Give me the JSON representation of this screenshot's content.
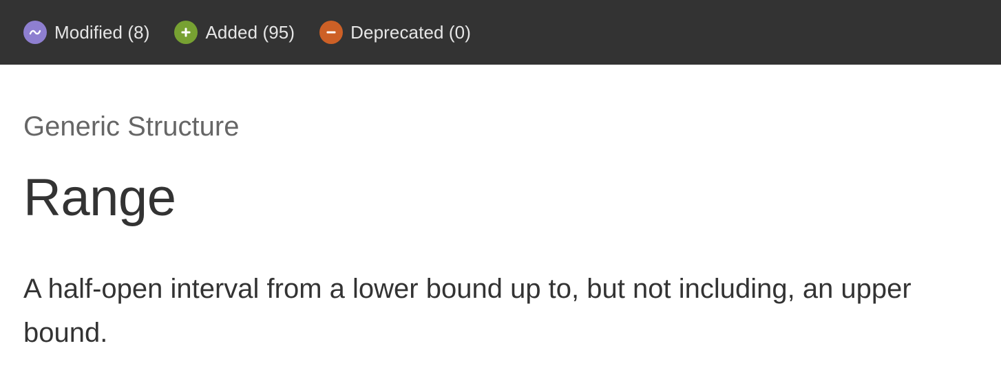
{
  "filters": [
    {
      "label": "Modified (8)",
      "icon": "modified-icon",
      "color": "#8e7fd0"
    },
    {
      "label": "Added (95)",
      "icon": "added-icon",
      "color": "#77a132"
    },
    {
      "label": "Deprecated (0)",
      "icon": "deprecated-icon",
      "color": "#cd6026"
    }
  ],
  "main": {
    "eyebrow": "Generic Structure",
    "title": "Range",
    "abstract": "A half-open interval from a lower bound up to, but not including, an upper bound."
  }
}
